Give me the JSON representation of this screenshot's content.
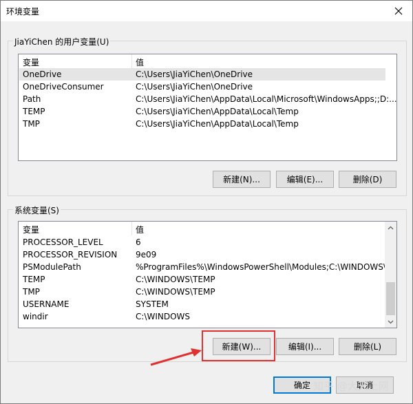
{
  "window": {
    "title": "环境变量"
  },
  "user_vars": {
    "group_title": "JiaYiChen 的用户变量(U)",
    "columns": [
      "变量",
      "值"
    ],
    "rows": [
      {
        "name": "OneDrive",
        "value": "C:\\Users\\JiaYiChen\\OneDrive"
      },
      {
        "name": "OneDriveConsumer",
        "value": "C:\\Users\\JiaYiChen\\OneDrive"
      },
      {
        "name": "Path",
        "value": "C:\\Users\\JiaYiChen\\AppData\\Local\\Microsoft\\WindowsApps;;D:..."
      },
      {
        "name": "TEMP",
        "value": "C:\\Users\\JiaYiChen\\AppData\\Local\\Temp"
      },
      {
        "name": "TMP",
        "value": "C:\\Users\\JiaYiChen\\AppData\\Local\\Temp"
      }
    ],
    "buttons": {
      "new": "新建(N)...",
      "edit": "编辑(E)...",
      "delete": "删除(D)"
    }
  },
  "system_vars": {
    "group_title": "系统变量(S)",
    "columns": [
      "变量",
      "值"
    ],
    "rows": [
      {
        "name": "PROCESSOR_LEVEL",
        "value": "6"
      },
      {
        "name": "PROCESSOR_REVISION",
        "value": "9e09"
      },
      {
        "name": "PSModulePath",
        "value": "%ProgramFiles%\\WindowsPowerShell\\Modules;C:\\WINDOWS\\s..."
      },
      {
        "name": "TEMP",
        "value": "C:\\WINDOWS\\TEMP"
      },
      {
        "name": "TMP",
        "value": "C:\\WINDOWS\\TEMP"
      },
      {
        "name": "USERNAME",
        "value": "SYSTEM"
      },
      {
        "name": "windir",
        "value": "C:\\WINDOWS"
      }
    ],
    "buttons": {
      "new": "新建(W)...",
      "edit": "编辑(I)...",
      "delete": "删除(L)"
    }
  },
  "footer": {
    "ok": "确定",
    "cancel": "取消"
  },
  "watermark": "知乎 @大天上网",
  "icons": {
    "close": "close-icon",
    "scroll_up": "chevron-up-icon",
    "scroll_down": "chevron-down-icon",
    "annotation": "red-arrow-icon"
  },
  "colors": {
    "highlight_box": "#e03030",
    "default_button_border": "#0078d7",
    "selected_row": "#e5e5e5"
  }
}
